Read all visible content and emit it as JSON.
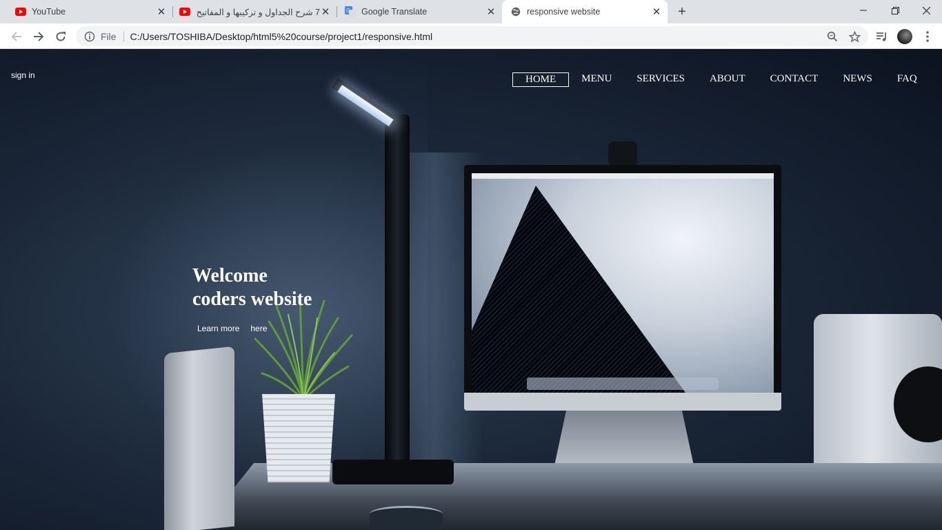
{
  "browser": {
    "tabs": [
      {
        "title": "YouTube",
        "favicon": "youtube-icon"
      },
      {
        "title": "7 شرح الجداول و تركيبها و المفاتيح",
        "favicon": "youtube-icon"
      },
      {
        "title": "Google Translate",
        "favicon": "translate-icon"
      },
      {
        "title": "responsive website",
        "favicon": "globe-icon",
        "active": true
      }
    ],
    "new_tab": "+",
    "address": {
      "scheme_label": "File",
      "url": "C:/Users/TOSHIBA/Desktop/html5%20course/project1/responsive.html"
    },
    "colors": {
      "tabstrip": "#dee1e6",
      "toolbar": "#ffffff",
      "omnibox": "#f1f3f4",
      "youtube_red": "#ff0000"
    }
  },
  "page": {
    "signin": "sign in",
    "nav": [
      {
        "label": "HOME",
        "active": true
      },
      {
        "label": "MENU"
      },
      {
        "label": "SERVICES"
      },
      {
        "label": "ABOUT"
      },
      {
        "label": "CONTACT"
      },
      {
        "label": "NEWS"
      },
      {
        "label": "FAQ"
      }
    ],
    "hero": {
      "line1": "Welcome",
      "line2": "coders website",
      "link1": "Learn more",
      "link2": "here"
    }
  }
}
